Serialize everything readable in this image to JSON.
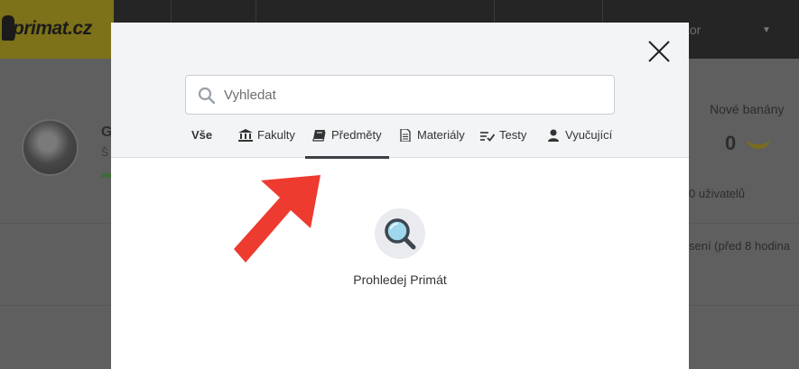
{
  "background": {
    "logo_text": "primat.cz",
    "nav_user_fragment": "tor",
    "user_initial": "G",
    "user_initial_2": "Š",
    "banana_title": "Nové banány",
    "banana_count": "0",
    "users_text": "0 uživatelů",
    "time_text": "sení (před 8 hodina"
  },
  "modal": {
    "close_label": "×",
    "search": {
      "placeholder": "Vyhledat",
      "value": ""
    },
    "tabs": [
      {
        "label": "Vše",
        "icon": "none"
      },
      {
        "label": "Fakulty",
        "icon": "bank-icon"
      },
      {
        "label": "Předměty",
        "icon": "book-icon"
      },
      {
        "label": "Materiály",
        "icon": "document-icon"
      },
      {
        "label": "Testy",
        "icon": "checklist-icon"
      },
      {
        "label": "Vyučující",
        "icon": "user-icon"
      }
    ],
    "active_tab": "Předměty",
    "empty_state": {
      "icon": "magnifier-icon",
      "text": "Prohledej Primát"
    }
  },
  "colors": {
    "arrow": "#ee3b2f",
    "overlay_bg": "#5f5f5f",
    "modal_header_bg": "#f3f4f6",
    "active_underline": "#3b3f45"
  }
}
